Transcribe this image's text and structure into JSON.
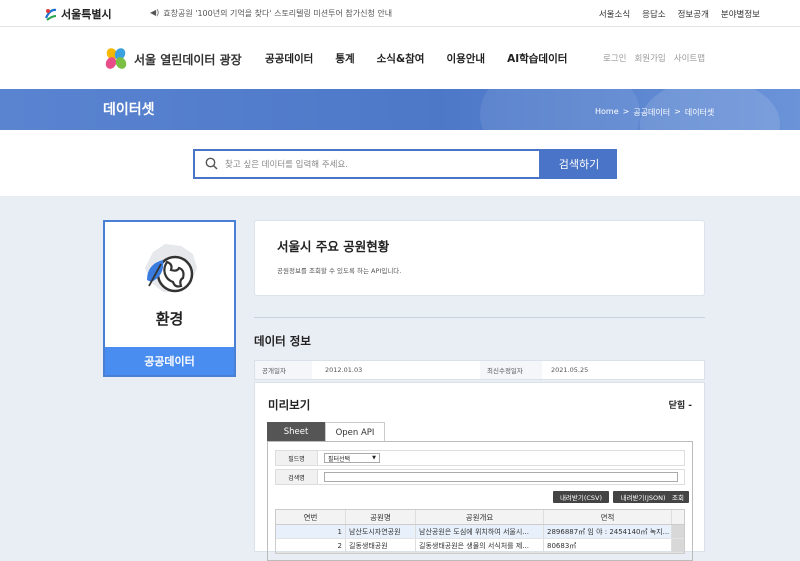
{
  "topbar": {
    "logo": "서울특별시",
    "notice": "효창공원 '100년의 기억을 찾다' 스토리텔링 미션투어 참가신청 안내",
    "util": [
      "서울소식",
      "응답소",
      "정보공개",
      "분야별정보"
    ]
  },
  "gnb": {
    "brand": "서울 열린데이터 광장",
    "menu": [
      "공공데이터",
      "통계",
      "소식&참여",
      "이용안내",
      "AI학습데이터"
    ],
    "account": [
      "로그인",
      "회원가입",
      "사이트맵"
    ]
  },
  "banner": {
    "title": "데이터셋",
    "crumbs": [
      "Home",
      "공공데이터",
      "데이터셋"
    ],
    "sep": ">"
  },
  "search": {
    "placeholder": "찾고 싶은 데이터를 입력해 주세요.",
    "button": "검색하기"
  },
  "category": {
    "name": "환경",
    "footer": "공공데이터"
  },
  "dataset": {
    "title": "서울시 주요 공원현황",
    "desc": "공원정보를 조회할 수 있도록 하는 API입니다."
  },
  "info": {
    "section_title": "데이터 정보",
    "public_label": "공개일자",
    "public_date": "2012.01.03",
    "modified_label": "최신수정일자",
    "modified_date": "2021.05.25"
  },
  "preview": {
    "title": "미리보기",
    "close": "닫힘 -",
    "tabs": [
      "Sheet",
      "Open API"
    ],
    "field_label": "필드명",
    "field_select": "필터선택",
    "search_label": "검색명",
    "buttons": [
      "내려받기(CSV)",
      "내려받기(JSON)",
      "조회"
    ],
    "columns": [
      "연번",
      "공원명",
      "공원개요",
      "면적"
    ],
    "rows": [
      [
        "1",
        "남산도시자연공원",
        "남산공원은 도심에 위치하여 서울시...",
        "2896887㎡ 임 야 : 2454140㎡ 녹지..."
      ],
      [
        "2",
        "길동생태공원",
        "길동생태공원은 생물의 서식처를 제...",
        "80683㎡"
      ]
    ]
  },
  "colors": {
    "accent": "#4a74c7",
    "category_border": "#4a7fd6",
    "category_footer": "#4a8df0",
    "page_bg": "#e9eef5"
  }
}
